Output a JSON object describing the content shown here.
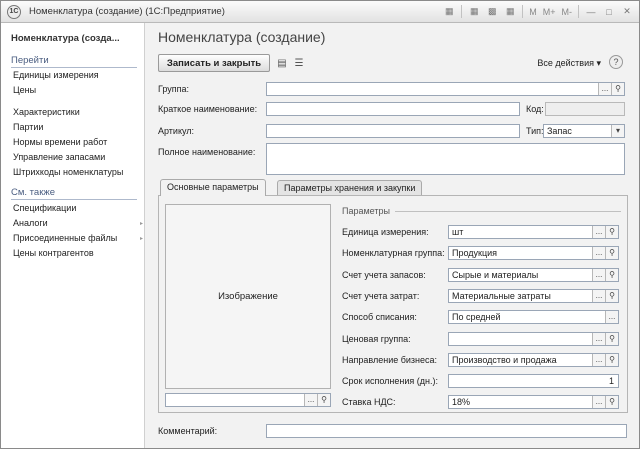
{
  "window": {
    "title": "Номенклатура (создание)  (1С:Предприятие)",
    "logo": "1С",
    "toolbar_icons": [
      "save-icon",
      "table-icon",
      "calc-icon",
      "calendar-icon"
    ],
    "memory": [
      "M",
      "M+",
      "M-"
    ]
  },
  "sidebar": {
    "title": "Номенклатура (созда...",
    "go_title": "Перейти",
    "go_items": [
      "Единицы измерения",
      "Цены",
      "Характеристики",
      "Партии",
      "Нормы времени работ",
      "Управление запасами",
      "Штрихкоды номенклатуры"
    ],
    "see_title": "См. также",
    "see_items": [
      "Спецификации",
      "Аналоги",
      "Присоединенные файлы",
      "Цены контрагентов"
    ]
  },
  "main": {
    "title": "Номенклатура (создание)",
    "save_close": "Записать и закрыть",
    "all_actions": "Все действия ▾",
    "help": "?"
  },
  "form": {
    "group_label": "Группа:",
    "group_value": "",
    "short_label": "Краткое наименование:",
    "short_value": "",
    "code_label": "Код:",
    "code_value": "",
    "article_label": "Артикул:",
    "article_value": "",
    "type_label": "Тип:",
    "type_value": "Запас",
    "full_label": "Полное наименование:",
    "full_value": "",
    "comment_label": "Комментарий:",
    "comment_value": ""
  },
  "tabs": [
    "Основные параметры",
    "Параметры хранения и закупки"
  ],
  "image_label": "Изображение",
  "params": {
    "title": "Параметры",
    "rows": [
      {
        "label": "Единица измерения:",
        "value": "шт"
      },
      {
        "label": "Номенклатурная группа:",
        "value": "Продукция"
      },
      {
        "label": "Счет учета запасов:",
        "value": "Сырые и материалы"
      },
      {
        "label": "Счет учета затрат:",
        "value": "Материальные затраты"
      },
      {
        "label": "Способ списания:",
        "value": "По средней"
      },
      {
        "label": "Ценовая группа:",
        "value": ""
      },
      {
        "label": "Направление бизнеса:",
        "value": "Производство и продажа"
      },
      {
        "label": "Срок исполнения (дн.):",
        "value": "1"
      },
      {
        "label": "Ставка НДС:",
        "value": "18%"
      }
    ]
  }
}
